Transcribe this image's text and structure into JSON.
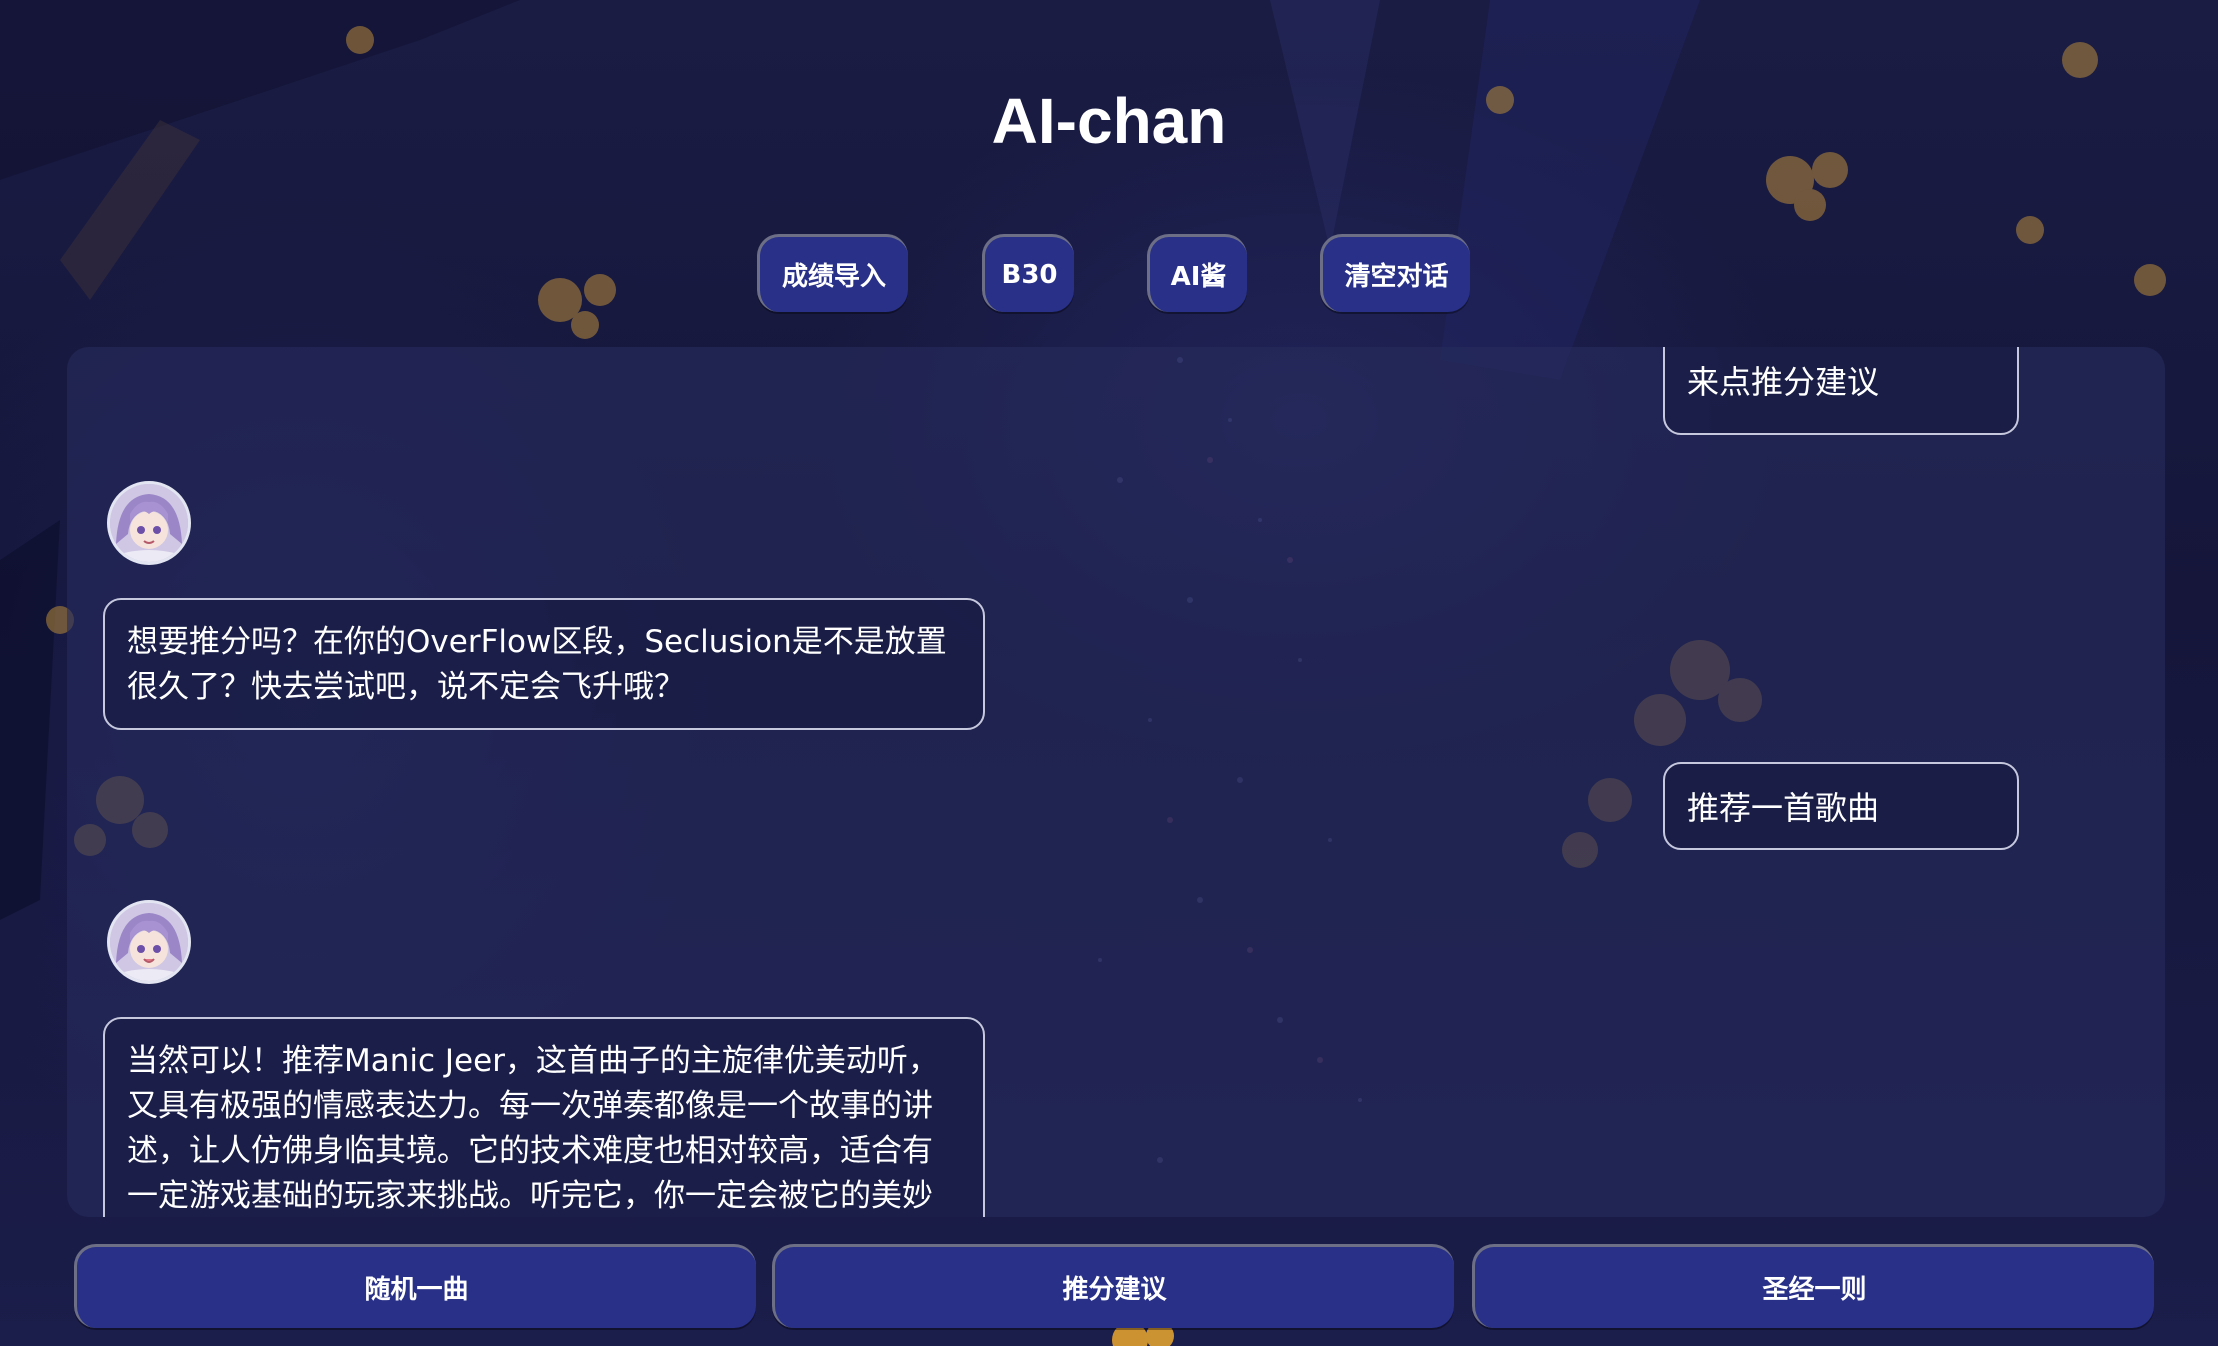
{
  "app": {
    "title": "AI-chan"
  },
  "top_buttons": {
    "import": "成绩导入",
    "b30": "B30",
    "ai": "AI酱",
    "clear": "清空对话"
  },
  "chat": {
    "messages": [
      {
        "role": "user",
        "text": "来点推分建议"
      },
      {
        "role": "bot",
        "avatar": "anime-girl-avatar",
        "text": "想要推分吗？在你的OverFlow区段，Seclusion是不是放置很久了？快去尝试吧，说不定会飞升哦？"
      },
      {
        "role": "user",
        "text": "推荐一首歌曲"
      },
      {
        "role": "bot",
        "avatar": "anime-girl-avatar",
        "text": "当然可以！推荐Manic Jeer，这首曲子的主旋律优美动听，又具有极强的情感表达力。每一次弹奏都像是一个故事的讲述，让人仿佛身临其境。它的技术难度也相对较高，适合有一定游戏基础的玩家来挑战。听完它，你一定会被它的美妙"
      }
    ]
  },
  "bottom_buttons": {
    "random": "随机一曲",
    "advice": "推分建议",
    "quote": "圣经一则"
  },
  "colors": {
    "button": "#283088",
    "panel": "#262c5c",
    "bubble_border": "#c6c8de",
    "text": "#ffffff"
  }
}
